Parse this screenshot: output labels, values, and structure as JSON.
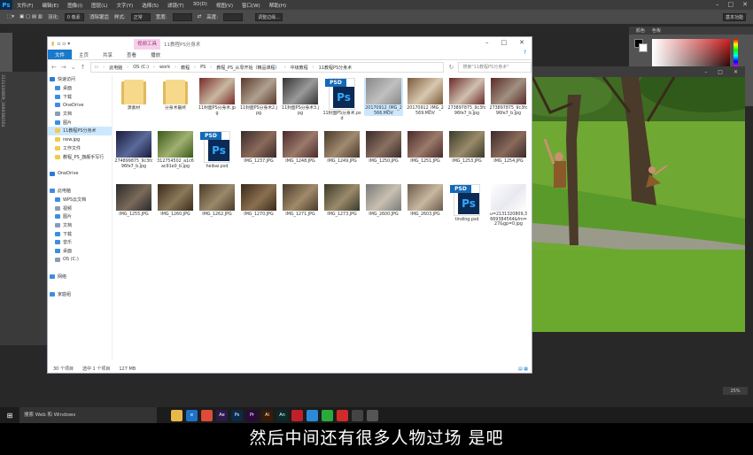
{
  "ps": {
    "logo": "Ps",
    "menu": [
      "文件(F)",
      "编辑(E)",
      "图像(I)",
      "图层(L)",
      "文字(Y)",
      "选择(S)",
      "滤镜(T)",
      "3D(D)",
      "视图(V)",
      "窗口(W)",
      "帮助(H)"
    ],
    "options": {
      "feather_label": "羽化:",
      "feather_value": "0 像素",
      "antialias": "消除锯齿",
      "style_label": "样式:",
      "style_value": "正常",
      "width_label": "宽度:",
      "height_label": "高度:",
      "refine": "调整边缘...",
      "workspace": "基本功能"
    },
    "side_coords": "3131320809_3669384564",
    "panel_tabs": [
      "颜色",
      "色板"
    ],
    "zoom": "25%"
  },
  "explorer": {
    "context_tab": "视频工具",
    "title": "11教程PS分身术",
    "ribbon": [
      "文件",
      "主页",
      "共享",
      "查看",
      "播放"
    ],
    "path": [
      "此电脑",
      "OS (C:)",
      "work",
      "教程",
      "PS",
      "教程_PS_从零开始（精品课程）",
      "中级教程",
      "11教程PS分身术"
    ],
    "search_placeholder": "搜索\"11教程PS分身术\"",
    "nav": [
      {
        "label": "快速访问",
        "color": "#2b7bd6",
        "indent": 2
      },
      {
        "label": "桌面",
        "color": "#3d8de0",
        "indent": 8
      },
      {
        "label": "下载",
        "color": "#3d8de0",
        "indent": 8
      },
      {
        "label": "OneDrive",
        "color": "#3d8de0",
        "indent": 8
      },
      {
        "label": "文档",
        "color": "#8a9bb5",
        "indent": 8
      },
      {
        "label": "图片",
        "color": "#3d8de0",
        "indent": 8
      },
      {
        "label": "11教程PS分身术",
        "color": "#f2c94c",
        "indent": 8,
        "selected": true
      },
      {
        "label": "new.jpg",
        "color": "#f2c94c",
        "indent": 8
      },
      {
        "label": "工作文件",
        "color": "#f2c94c",
        "indent": 8
      },
      {
        "label": "教程_PS_旗舰手写行",
        "color": "#f2c94c",
        "indent": 8
      },
      {
        "label": "",
        "color": "",
        "indent": 0
      },
      {
        "label": "OneDrive",
        "color": "#2b7bd6",
        "indent": 2
      },
      {
        "label": "",
        "color": "",
        "indent": 0
      },
      {
        "label": "此电脑",
        "color": "#3d8de0",
        "indent": 2
      },
      {
        "label": "WPS云文档",
        "color": "#3d8de0",
        "indent": 8
      },
      {
        "label": "视频",
        "color": "#8a9bb5",
        "indent": 8
      },
      {
        "label": "图片",
        "color": "#3d8de0",
        "indent": 8
      },
      {
        "label": "文档",
        "color": "#8a9bb5",
        "indent": 8
      },
      {
        "label": "下载",
        "color": "#3d8de0",
        "indent": 8
      },
      {
        "label": "音乐",
        "color": "#3d8de0",
        "indent": 8
      },
      {
        "label": "桌面",
        "color": "#3d8de0",
        "indent": 8
      },
      {
        "label": "OS (C:)",
        "color": "#8a9bb5",
        "indent": 8
      },
      {
        "label": "",
        "color": "",
        "indent": 0
      },
      {
        "label": "网络",
        "color": "#3d8de0",
        "indent": 2
      },
      {
        "label": "",
        "color": "",
        "indent": 0
      },
      {
        "label": "家庭组",
        "color": "#3d8de0",
        "indent": 2
      }
    ],
    "files": [
      {
        "name": "源素材",
        "kind": "folder"
      },
      {
        "name": "分身术最终",
        "kind": "folder"
      },
      {
        "name": "11封面PS分身术.jpg",
        "kind": "img",
        "c1": "#7a2a2a",
        "c2": "#c8b8a0"
      },
      {
        "name": "11封面PS分身术2.jpg",
        "kind": "img",
        "c1": "#5a3a2a",
        "c2": "#b0a090"
      },
      {
        "name": "11封面PS分身术3.jpg",
        "kind": "img",
        "c1": "#333333",
        "c2": "#999999"
      },
      {
        "name": "11封面PS分身术.psd",
        "kind": "psd"
      },
      {
        "name": "20170912_IMG_2566.MOV",
        "kind": "img",
        "c1": "#888888",
        "c2": "#c0c0c0",
        "selected": true
      },
      {
        "name": "20170912_IMG_2569.MOV",
        "kind": "img",
        "c1": "#7a5a3a",
        "c2": "#d8c8b0"
      },
      {
        "name": "273897875_9c3fc96fe7_b.jpg",
        "kind": "img",
        "c1": "#6a2a2a",
        "c2": "#d0c0b0"
      },
      {
        "name": "273897875_9c3fc96fe7_b.jpg",
        "kind": "img",
        "c1": "#5a2a2a",
        "c2": "#a09080"
      },
      {
        "name": "274899875_9c3fc96fe7_b.jpg",
        "kind": "img",
        "c1": "#1a1a3a",
        "c2": "#5a6a9a"
      },
      {
        "name": "312754502_a1c6ac91e0_b.jpg",
        "kind": "img",
        "c1": "#3a5a1a",
        "c2": "#a0b070"
      },
      {
        "name": "heibai.psd",
        "kind": "psd"
      },
      {
        "name": "IMG_1237.JPG",
        "kind": "img",
        "c1": "#3a2a2a",
        "c2": "#8a6a5a"
      },
      {
        "name": "IMG_1248.JPG",
        "kind": "img",
        "c1": "#4a2a2a",
        "c2": "#9a7a6a"
      },
      {
        "name": "IMG_1249.JPG",
        "kind": "img",
        "c1": "#4a3a2a",
        "c2": "#a08a70"
      },
      {
        "name": "IMG_1250.JPG",
        "kind": "img",
        "c1": "#3a2a2a",
        "c2": "#8a7060"
      },
      {
        "name": "IMG_1251.JPG",
        "kind": "img",
        "c1": "#4a2a2a",
        "c2": "#9a7a6a"
      },
      {
        "name": "IMG_1253.JPG",
        "kind": "img",
        "c1": "#3a3a2a",
        "c2": "#9a8a6a"
      },
      {
        "name": "IMG_1254.JPG",
        "kind": "img",
        "c1": "#3a2a2a",
        "c2": "#8a6a5a"
      },
      {
        "name": "IMG_1255.JPG",
        "kind": "img",
        "c1": "#2a2a2a",
        "c2": "#7a6a5a"
      },
      {
        "name": "IMG_1260.JPG",
        "kind": "img",
        "c1": "#3a2a1a",
        "c2": "#8a7a5a"
      },
      {
        "name": "IMG_1262.JPG",
        "kind": "img",
        "c1": "#4a3a2a",
        "c2": "#9a8a6a"
      },
      {
        "name": "IMG_1270.JPG",
        "kind": "img",
        "c1": "#3a2a1a",
        "c2": "#8a7050"
      },
      {
        "name": "IMG_1271.JPG",
        "kind": "img",
        "c1": "#4a3a2a",
        "c2": "#a08a6a"
      },
      {
        "name": "IMG_1273.JPG",
        "kind": "img",
        "c1": "#3a3a2a",
        "c2": "#9a8a6a"
      },
      {
        "name": "IMG_2600.JPG",
        "kind": "img",
        "c1": "#7a7a7a",
        "c2": "#c8c0b0"
      },
      {
        "name": "IMG_2603.JPG",
        "kind": "img",
        "c1": "#6a5a4a",
        "c2": "#c8b8a0"
      },
      {
        "name": "tinding.psd",
        "kind": "psd"
      },
      {
        "name": "u=2131320809,3669384564&fm=27&gp=0.jpg",
        "kind": "img",
        "c1": "#ffffff",
        "c2": "#e8e8f0"
      }
    ],
    "status": [
      "30 个项目",
      "选中 1 个项目",
      "127 MB"
    ]
  },
  "taskbar": {
    "start": "⊞",
    "search": "搜索 Web 和 Windows",
    "apps": [
      {
        "name": "file-explorer",
        "label": "",
        "color": "#e8b84a"
      },
      {
        "name": "edge",
        "label": "e",
        "color": "#1e73c8"
      },
      {
        "name": "chrome",
        "label": "",
        "color": "#dd4b39"
      },
      {
        "name": "after-effects",
        "label": "Ae",
        "color": "#2a1a4a"
      },
      {
        "name": "photoshop",
        "label": "Ps",
        "color": "#0a2a4a"
      },
      {
        "name": "premiere",
        "label": "Pr",
        "color": "#2a0a3a"
      },
      {
        "name": "illustrator",
        "label": "Ai",
        "color": "#3a1a0a"
      },
      {
        "name": "animate",
        "label": "An",
        "color": "#0a2a2a"
      },
      {
        "name": "netease-music",
        "label": "",
        "color": "#c0202a"
      },
      {
        "name": "browser",
        "label": "",
        "color": "#2a8ad8"
      },
      {
        "name": "wechat",
        "label": "",
        "color": "#2aaa3a"
      },
      {
        "name": "app",
        "label": "",
        "color": "#d02a2a"
      },
      {
        "name": "photos",
        "label": "",
        "color": "#444444"
      },
      {
        "name": "media",
        "label": "",
        "color": "#555555"
      }
    ],
    "tray": [
      "",
      "",
      ""
    ]
  },
  "subtitle": "然后中间还有很多人物过场 是吧"
}
